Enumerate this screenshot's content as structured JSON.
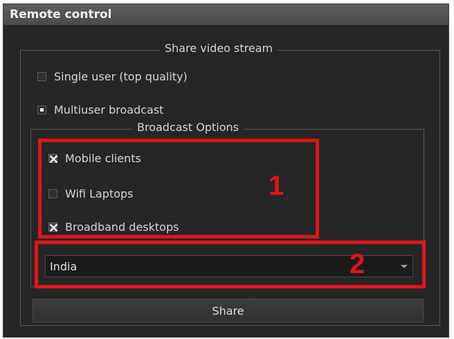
{
  "window": {
    "title": "Remote control"
  },
  "share_video_stream": {
    "legend": "Share video stream",
    "options": [
      {
        "label": "Single user (top quality)",
        "selected": false
      },
      {
        "label": "Multiuser broadcast",
        "selected": true
      }
    ]
  },
  "broadcast_options": {
    "legend": "Broadcast Options",
    "items": [
      {
        "label": "Mobile clients",
        "checked": true
      },
      {
        "label": "Wifi Laptops",
        "checked": false
      },
      {
        "label": "Broadband desktops",
        "checked": true
      }
    ]
  },
  "region_select": {
    "value": "India"
  },
  "share_button": {
    "label": "Share"
  },
  "annotations": {
    "marker_1": "1",
    "marker_2": "2",
    "color": "#e0141c"
  },
  "colors": {
    "panel_background": "#262626",
    "title_bar": "#5e5e5e",
    "text": "#d6d6d6"
  }
}
